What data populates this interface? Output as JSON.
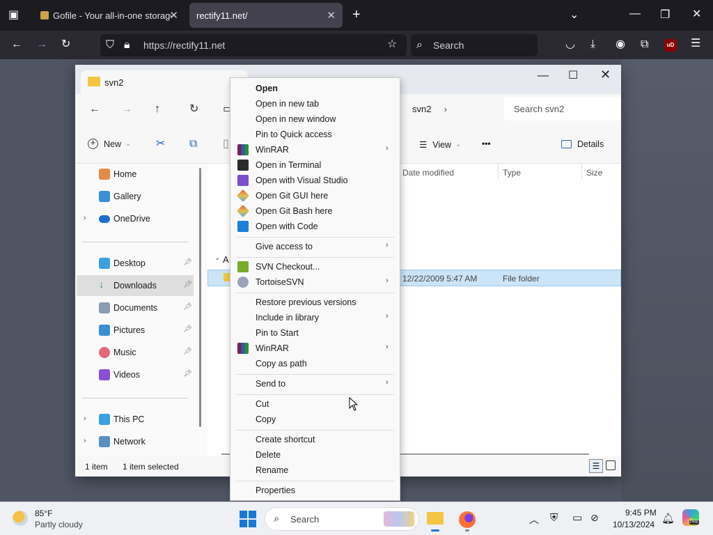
{
  "browser": {
    "tabs": [
      {
        "title": "Gofile - Your all-in-one storage"
      },
      {
        "title": "rectify11.net/"
      }
    ],
    "url": "https://rectify11.net",
    "search_placeholder": "Search",
    "ext_badge": "uD"
  },
  "explorer": {
    "tab_title": "svn2",
    "breadcrumb": "svn2",
    "search_placeholder": "Search svn2",
    "commands": {
      "new": "New",
      "view": "View",
      "more": "•••",
      "details": "Details"
    },
    "columns": [
      "Date modified",
      "Type",
      "Size"
    ],
    "group_label": "A",
    "row": {
      "date": "12/22/2009 5:47 AM",
      "type": "File folder"
    },
    "sidebar": [
      {
        "label": "Home"
      },
      {
        "label": "Gallery"
      },
      {
        "label": "OneDrive"
      },
      {
        "label": "Desktop"
      },
      {
        "label": "Downloads"
      },
      {
        "label": "Documents"
      },
      {
        "label": "Pictures"
      },
      {
        "label": "Music"
      },
      {
        "label": "Videos"
      },
      {
        "label": "This PC"
      },
      {
        "label": "Network"
      }
    ],
    "status": {
      "items": "1 item",
      "selected": "1 item selected"
    }
  },
  "context_menu": {
    "items": [
      "Open",
      "Open in new tab",
      "Open in new window",
      "Pin to Quick access",
      "WinRAR",
      "Open in Terminal",
      "Open with Visual Studio",
      "Open Git GUI here",
      "Open Git Bash here",
      "Open with Code",
      "Give access to",
      "SVN Checkout...",
      "TortoiseSVN",
      "Restore previous versions",
      "Include in library",
      "Pin to Start",
      "WinRAR",
      "Copy as path",
      "Send to",
      "Cut",
      "Copy",
      "Create shortcut",
      "Delete",
      "Rename",
      "Properties"
    ]
  },
  "taskbar": {
    "weather_temp": "85°F",
    "weather_desc": "Partly cloudy",
    "search": "Search",
    "time": "9:45 PM",
    "date": "10/13/2024",
    "copilot_badge": "PRE"
  }
}
